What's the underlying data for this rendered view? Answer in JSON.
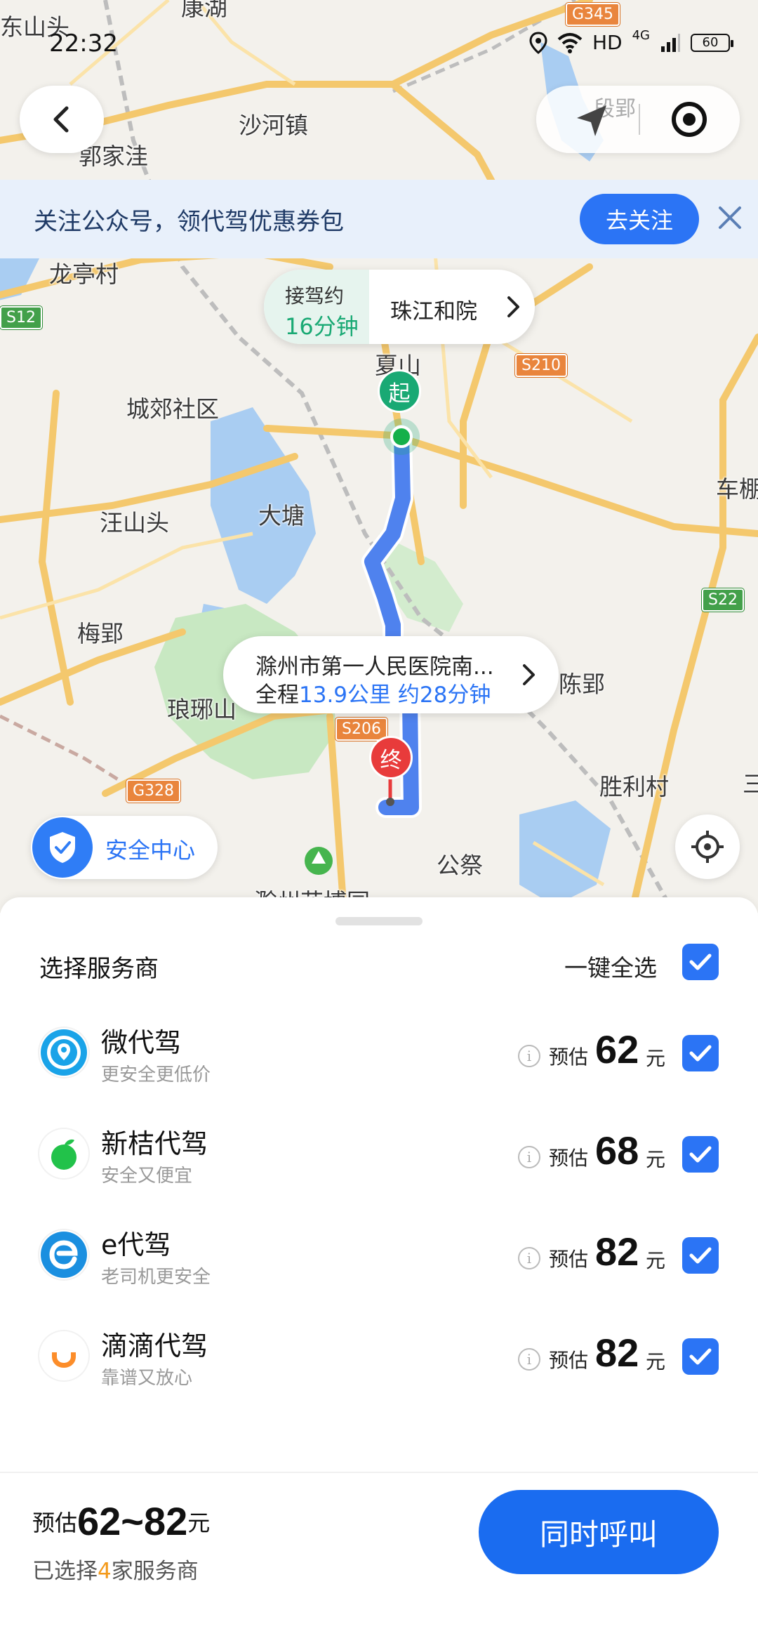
{
  "status_bar": {
    "time": "22:32",
    "network": "HD",
    "signal": "4G",
    "battery": "60"
  },
  "colors": {
    "accent": "#2b74f5",
    "start": "#19a974",
    "end": "#e83b3b",
    "highlight": "#f39a1b"
  },
  "map": {
    "places": [
      "东山头",
      "康湖",
      "沙河镇",
      "郭家洼",
      "龙亭村",
      "城郊社区",
      "汪山头",
      "大塘",
      "梅郢",
      "琅琊山",
      "陈郢",
      "胜利村",
      "公祭",
      "车棚",
      "夏山",
      "滁州花博园",
      "段郢",
      "三"
    ],
    "road_shields": [
      "G345",
      "S12",
      "S210",
      "S22",
      "S206",
      "G328"
    ],
    "search_hint": "段郢"
  },
  "follow_banner": {
    "text": "关注公众号，领代驾优惠券包",
    "button": "去关注"
  },
  "pickup": {
    "label": "接驾约",
    "minutes": "16分钟",
    "name": "珠江和院"
  },
  "start_marker": "起",
  "end_marker": "终",
  "destination": {
    "name": "滁州市第一人民医院南...",
    "prefix": "全程",
    "distance": "13.9公里",
    "duration": "约28分钟"
  },
  "safety_center": "安全中心",
  "sheet": {
    "title": "选择服务商",
    "select_all": "一键全选",
    "providers": [
      {
        "name": "微代驾",
        "sub": "更安全更低价",
        "est": "预估",
        "price": "62",
        "unit": "元",
        "checked": true,
        "icon": "weidaijia-logo-icon"
      },
      {
        "name": "新桔代驾",
        "sub": "安全又便宜",
        "est": "预估",
        "price": "68",
        "unit": "元",
        "checked": true,
        "icon": "xinju-logo-icon"
      },
      {
        "name": "e代驾",
        "sub": "老司机更安全",
        "est": "预估",
        "price": "82",
        "unit": "元",
        "checked": true,
        "icon": "edaijia-logo-icon"
      },
      {
        "name": "滴滴代驾",
        "sub": "靠谱又放心",
        "est": "预估",
        "price": "82",
        "unit": "元",
        "checked": true,
        "icon": "didi-logo-icon"
      }
    ]
  },
  "footer": {
    "est": "预估",
    "range": "62~82",
    "unit": "元",
    "selected_prefix": "已选择",
    "selected_count": "4",
    "selected_suffix": "家服务商",
    "call_button": "同时呼叫"
  }
}
